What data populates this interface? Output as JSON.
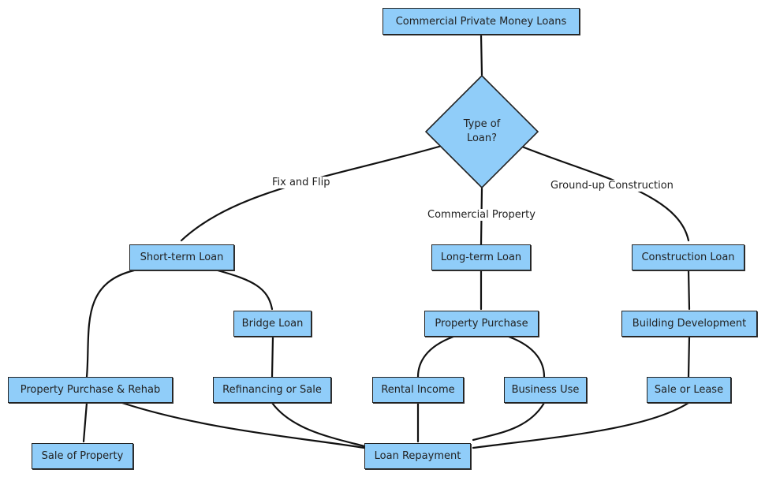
{
  "nodes": {
    "root": "Commercial Private Money Loans",
    "decision": "Type of\nLoan?",
    "short_term": "Short-term Loan",
    "long_term": "Long-term Loan",
    "construction": "Construction Loan",
    "bridge": "Bridge Loan",
    "purchase_rehab": "Property Purchase & Rehab",
    "refi_sale": "Refinancing or Sale",
    "sale_property": "Sale of Property",
    "property_purchase": "Property Purchase",
    "rental_income": "Rental Income",
    "business_use": "Business Use",
    "building_dev": "Building Development",
    "sale_lease": "Sale or Lease",
    "repayment": "Loan Repayment"
  },
  "edge_labels": {
    "fix_flip": "Fix and Flip",
    "commercial_property": "Commercial Property",
    "ground_up": "Ground-up Construction"
  },
  "colors": {
    "node_fill": "#90cdf9",
    "stroke": "#111111"
  }
}
